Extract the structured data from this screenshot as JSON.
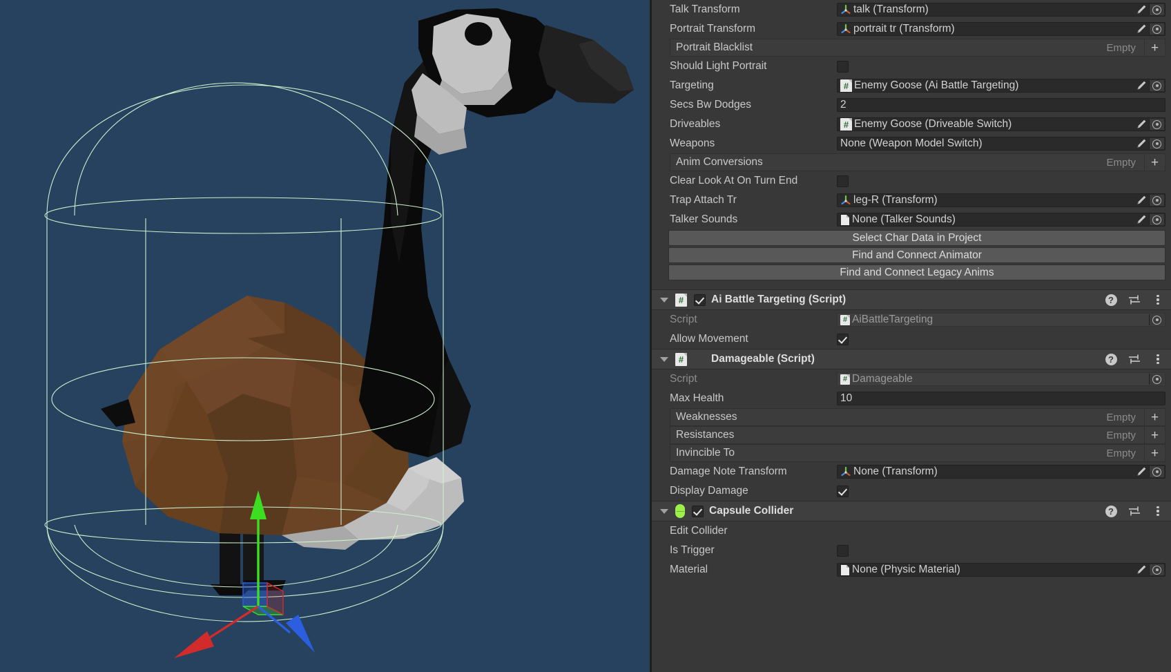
{
  "scene": {
    "background_color": "#26425f",
    "gizmo_color": "#cdf0cd",
    "axes": {
      "x_color": "#d22b2b",
      "y_color": "#3ddd22",
      "z_color": "#2b5fe0"
    },
    "model": {
      "name": "enemy-goose",
      "neck_color": "#0a0a0a",
      "cheek_color": "#c8c8c8",
      "body_color": "#6b4426",
      "body_shadow_color": "#523317",
      "belly_color": "#b9b9b9",
      "beak_color": "#252525",
      "eye_color": "#0c0c0c"
    }
  },
  "inspector": {
    "char_data_rows": [
      {
        "label": "Talk Transform",
        "type": "objectref",
        "value": "talk (Transform)",
        "icon": "transform-icon"
      },
      {
        "label": "Portrait Transform",
        "type": "objectref",
        "value": "portrait tr (Transform)",
        "icon": "transform-icon"
      },
      {
        "label": "Portrait Blacklist",
        "type": "list",
        "empty_label": "Empty",
        "add_label": "+"
      },
      {
        "label": "Should Light Portrait",
        "type": "checkbox",
        "checked": false
      },
      {
        "label": "Targeting",
        "type": "objectref",
        "value": "Enemy Goose (Ai Battle Targeting)",
        "icon": "script-icon"
      },
      {
        "label": "Secs Bw Dodges",
        "type": "number",
        "value": "2"
      },
      {
        "label": "Driveables",
        "type": "objectref",
        "value": "Enemy Goose (Driveable Switch)",
        "icon": "script-icon"
      },
      {
        "label": "Weapons",
        "type": "objectref",
        "value": "None (Weapon Model Switch)",
        "icon": "none"
      },
      {
        "label": "Anim Conversions",
        "type": "list",
        "empty_label": "Empty",
        "add_label": "+"
      },
      {
        "label": "Clear Look At On Turn End",
        "type": "checkbox",
        "checked": false
      },
      {
        "label": "Trap Attach Tr",
        "type": "objectref",
        "value": "leg-R (Transform)",
        "icon": "transform-icon"
      },
      {
        "label": "Talker Sounds",
        "type": "objectref",
        "value": "None (Talker Sounds)",
        "icon": "asset-icon"
      }
    ],
    "char_data_buttons": [
      "Select Char Data in Project",
      "Find and Connect Animator",
      "Find and Connect Legacy Anims"
    ],
    "components": [
      {
        "title": "Ai Battle Targeting (Script)",
        "icon": "script-icon",
        "has_enable_checkbox": true,
        "enabled": true,
        "expanded": true,
        "header_icons": [
          "help-icon",
          "preset-icon",
          "kebab-menu-icon"
        ],
        "rows": [
          {
            "label": "Script",
            "type": "objectref",
            "value": "AiBattleTargeting",
            "icon": "script-icon",
            "readonly": true,
            "no_pencil": true
          },
          {
            "label": "Allow Movement",
            "type": "checkbox",
            "checked": true
          }
        ]
      },
      {
        "title": "Damageable (Script)",
        "icon": "script-icon",
        "has_enable_checkbox": false,
        "expanded": true,
        "header_icons": [
          "help-icon",
          "preset-icon",
          "kebab-menu-icon"
        ],
        "rows": [
          {
            "label": "Script",
            "type": "objectref",
            "value": "Damageable",
            "icon": "script-icon",
            "readonly": true,
            "no_pencil": true
          },
          {
            "label": "Max Health",
            "type": "number",
            "value": "10"
          },
          {
            "label": "Weaknesses",
            "type": "list",
            "empty_label": "Empty",
            "add_label": "+"
          },
          {
            "label": "Resistances",
            "type": "list",
            "empty_label": "Empty",
            "add_label": "+"
          },
          {
            "label": "Invincible To",
            "type": "list",
            "empty_label": "Empty",
            "add_label": "+"
          },
          {
            "label": "Damage Note Transform",
            "type": "objectref",
            "value": "None (Transform)",
            "icon": "transform-icon"
          },
          {
            "label": "Display Damage",
            "type": "checkbox",
            "checked": true
          }
        ]
      },
      {
        "title": "Capsule Collider",
        "icon": "capsule-collider-icon",
        "has_enable_checkbox": true,
        "enabled": true,
        "expanded": true,
        "header_icons": [
          "help-icon",
          "preset-icon",
          "kebab-menu-icon"
        ],
        "rows": [
          {
            "label": "Edit Collider",
            "type": "plain"
          },
          {
            "label": "Is Trigger",
            "type": "checkbox",
            "checked": false
          },
          {
            "label": "Material",
            "type": "objectref",
            "value": "None (Physic Material)",
            "icon": "asset-icon",
            "clipped": true
          }
        ]
      }
    ]
  }
}
